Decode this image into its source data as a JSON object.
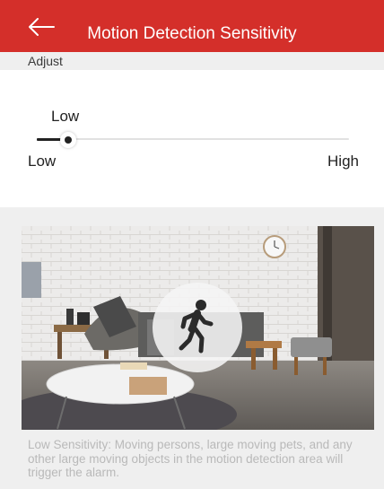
{
  "header": {
    "title": "Motion Detection Sensitivity",
    "background_color": "#d42f2a",
    "back_icon": "arrow-left-icon"
  },
  "section": {
    "label": "Adjust"
  },
  "slider": {
    "current_label": "Low",
    "min_label": "Low",
    "max_label": "High",
    "level": 0.1
  },
  "preview": {
    "icon": "walking-person-icon"
  },
  "description": "Low Sensitivity: Moving persons, large moving pets, and any other large moving objects in the motion detection area will trigger the alarm."
}
